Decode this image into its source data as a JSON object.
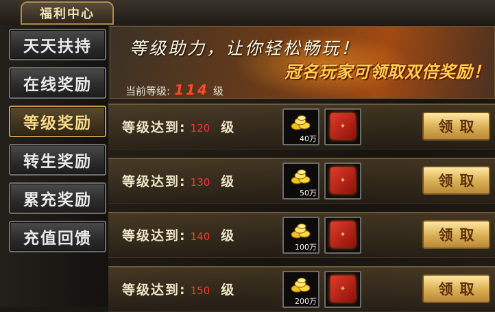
{
  "header": {
    "title": "福利中心"
  },
  "sidebar": {
    "items": [
      {
        "label": "天天扶持",
        "active": false
      },
      {
        "label": "在线奖励",
        "active": false
      },
      {
        "label": "等级奖励",
        "active": true
      },
      {
        "label": "转生奖励",
        "active": false
      },
      {
        "label": "累充奖励",
        "active": false
      },
      {
        "label": "充值回馈",
        "active": false
      }
    ]
  },
  "banner": {
    "slogan_line1": "等级助力，让你轻松畅玩！",
    "slogan_line2": "冠名玩家可领取双倍奖励！",
    "current_level_label": "当前等级:",
    "current_level": "114",
    "level_unit": "级"
  },
  "rewards": [
    {
      "req_label": "等级达到:",
      "level": "120",
      "unit": "级",
      "gold_qty": "40万",
      "book_icon": "red-skill-book-icon",
      "claim_label": "领取"
    },
    {
      "req_label": "等级达到:",
      "level": "130",
      "unit": "级",
      "gold_qty": "50万",
      "book_icon": "red-skill-book-icon",
      "claim_label": "领取"
    },
    {
      "req_label": "等级达到:",
      "level": "140",
      "unit": "级",
      "gold_qty": "100万",
      "book_icon": "red-skill-book-icon",
      "claim_label": "领取"
    },
    {
      "req_label": "等级达到:",
      "level": "150",
      "unit": "级",
      "gold_qty": "200万",
      "book_icon": "red-skill-book-icon",
      "claim_label": "领取"
    }
  ],
  "colors": {
    "accent_gold": "#d9ae52",
    "level_red": "#ff3535",
    "slogan_yellow": "#ffd24a"
  }
}
